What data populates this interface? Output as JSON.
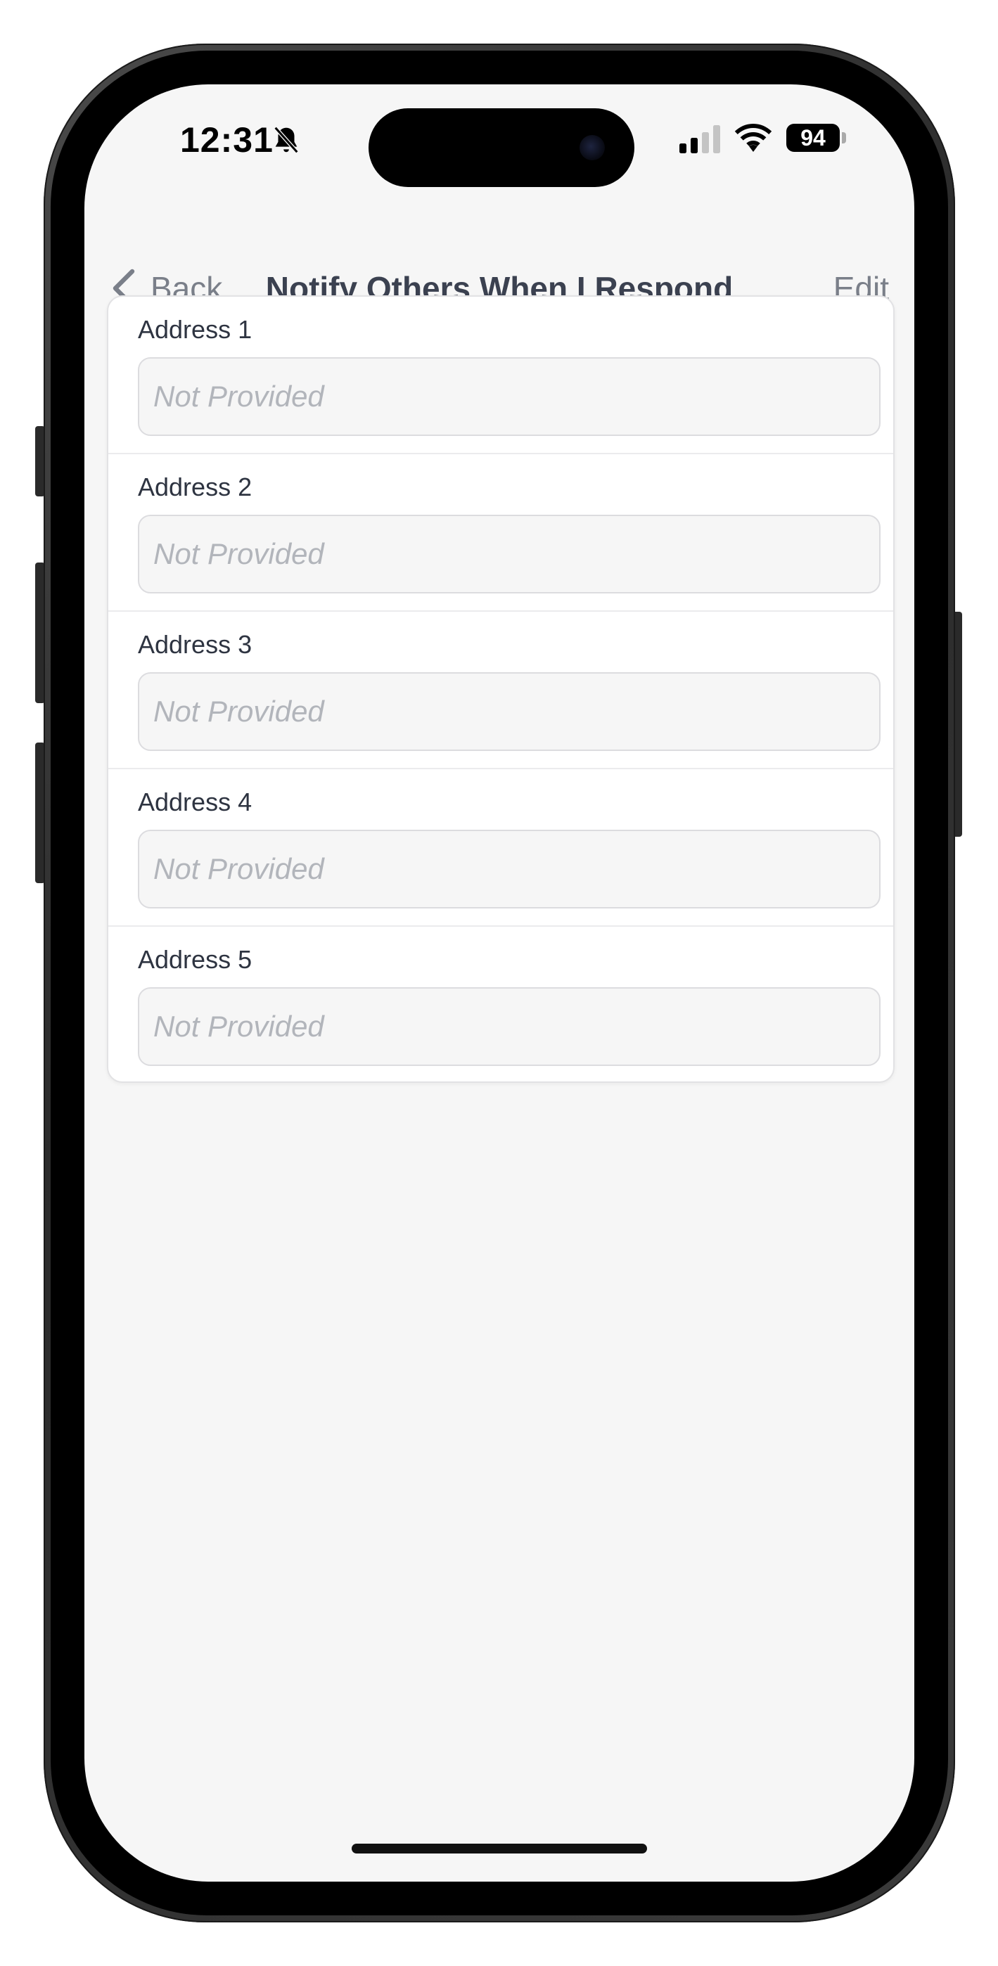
{
  "status_bar": {
    "time": "12:31",
    "battery": "94",
    "icons": [
      "bell-slash-icon",
      "signal-icon",
      "wifi-icon",
      "battery-icon"
    ]
  },
  "nav": {
    "back_label": "Back",
    "title": "Notify Others When I Respond",
    "edit_label": "Edit"
  },
  "fields": [
    {
      "label": "Address 1",
      "placeholder": "Not Provided"
    },
    {
      "label": "Address 2",
      "placeholder": "Not Provided"
    },
    {
      "label": "Address 3",
      "placeholder": "Not Provided"
    },
    {
      "label": "Address 4",
      "placeholder": "Not Provided"
    },
    {
      "label": "Address 5",
      "placeholder": "Not Provided"
    }
  ],
  "colors": {
    "background": "#f6f6f6",
    "card": "#ffffff",
    "title": "#3b4150",
    "nav_secondary": "#7a7f89",
    "placeholder": "#b2b5bb"
  }
}
